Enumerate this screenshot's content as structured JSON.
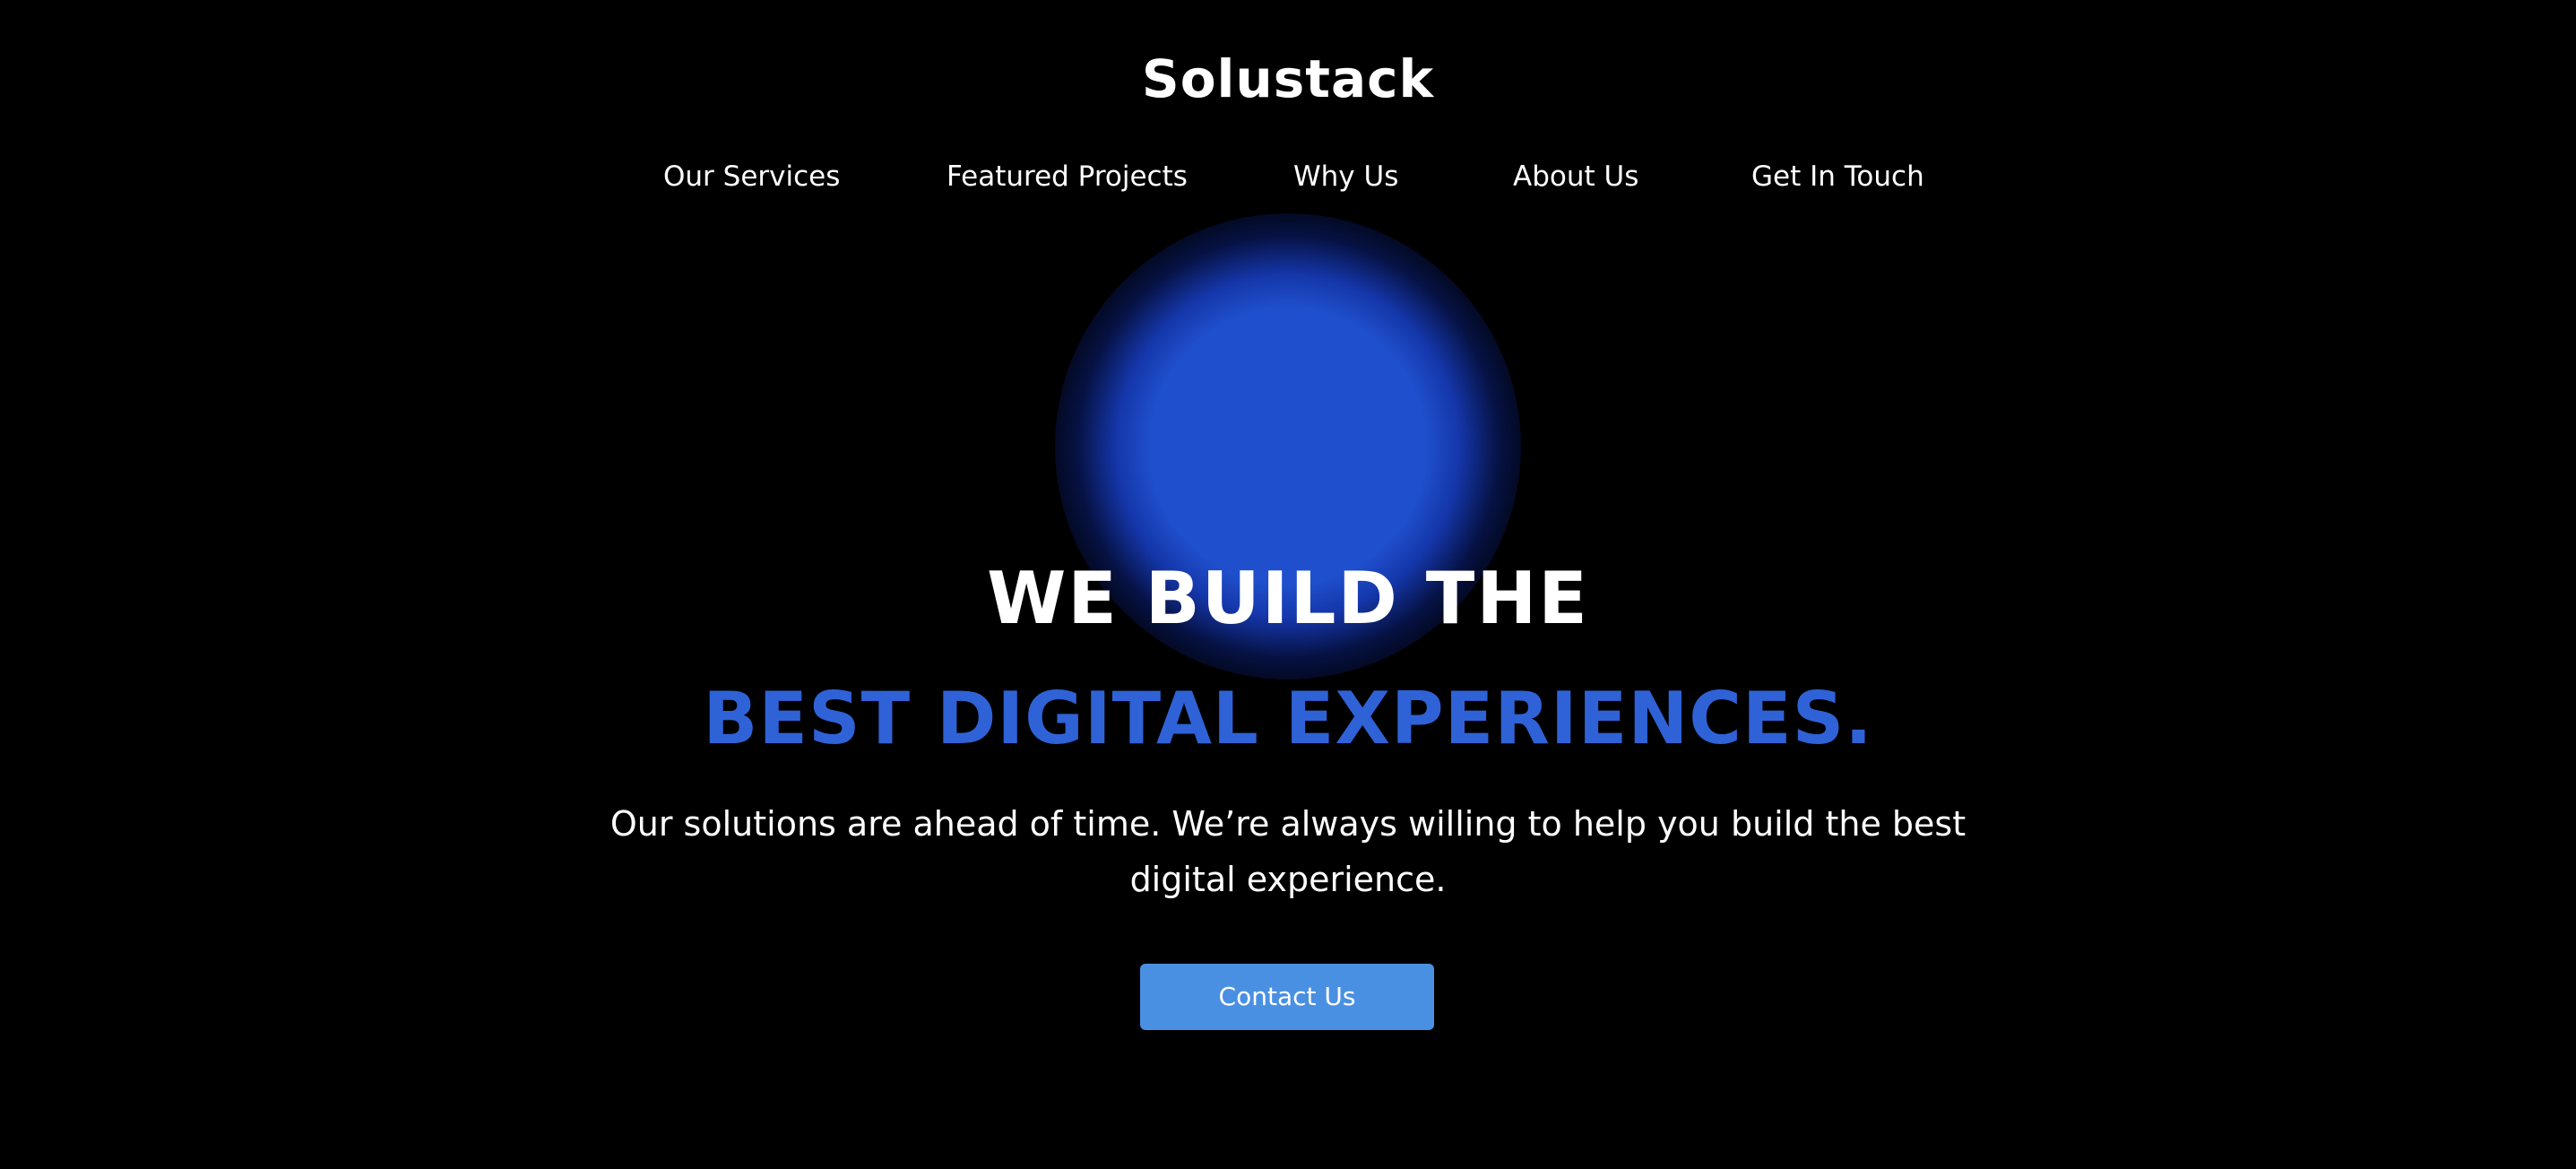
{
  "header": {
    "logo_text": "Solustack",
    "nav": {
      "items": [
        {
          "label": "Our Services"
        },
        {
          "label": "Featured Projects"
        },
        {
          "label": "Why Us"
        },
        {
          "label": "About Us"
        },
        {
          "label": "Get In Touch"
        }
      ]
    }
  },
  "hero": {
    "title_line1": "WE BUILD THE",
    "title_line2": "BEST DIGITAL EXPERIENCES.",
    "subtitle": "Our solutions are ahead of time. We’re always willing to help you build the best digital experience.",
    "cta_label": "Contact Us"
  },
  "colors": {
    "background": "#000000",
    "accent_blue": "#2f62d6",
    "glow_blue": "#1f4fcc",
    "button_blue": "#4a90e2",
    "text_white": "#ffffff"
  }
}
